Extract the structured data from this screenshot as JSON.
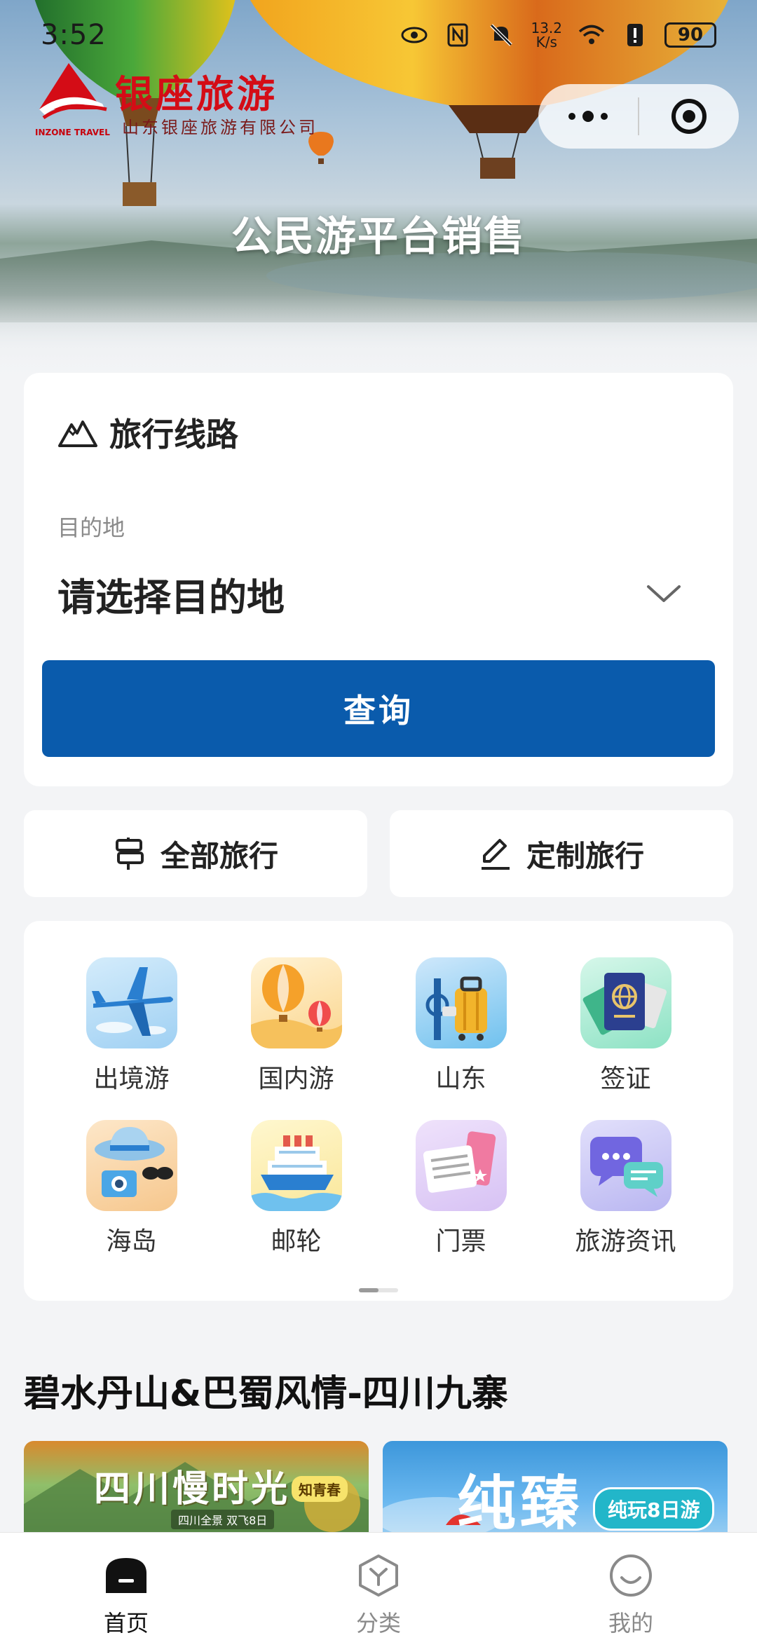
{
  "status_bar": {
    "time": "3:52",
    "net_speed_value": "13.2",
    "net_speed_unit": "K/s",
    "battery": "90"
  },
  "brand": {
    "name_cn": "银座旅游",
    "name_en": "INZONE TRAVEL",
    "subtitle": "山东银座旅游有限公司"
  },
  "hero": {
    "title": "公民游平台销售"
  },
  "search": {
    "section_title": "旅行线路",
    "destination_label": "目的地",
    "destination_placeholder": "请选择目的地",
    "query_button": "查询"
  },
  "quick_buttons": {
    "all_travel": "全部旅行",
    "custom_travel": "定制旅行"
  },
  "categories": [
    {
      "label": "出境游",
      "icon": "airplane-icon"
    },
    {
      "label": "国内游",
      "icon": "hot-air-balloon-icon"
    },
    {
      "label": "山东",
      "icon": "luggage-icon"
    },
    {
      "label": "签证",
      "icon": "passport-icon"
    },
    {
      "label": "海岛",
      "icon": "beach-hat-icon"
    },
    {
      "label": "邮轮",
      "icon": "cruise-ship-icon"
    },
    {
      "label": "门票",
      "icon": "ticket-icon"
    },
    {
      "label": "旅游资讯",
      "icon": "chat-bubble-icon"
    }
  ],
  "featured": {
    "section_title": "碧水丹山&巴蜀风情-四川九寨",
    "cards": [
      {
        "headline": "四川慢时光",
        "tag": "知青春",
        "sub": "四川全景 双飞8日"
      },
      {
        "headline": "纯臻",
        "badge": "纯玩8日游",
        "badge_script": "travel"
      }
    ]
  },
  "tabbar": {
    "items": [
      {
        "label": "首页",
        "active": true
      },
      {
        "label": "分类",
        "active": false
      },
      {
        "label": "我的",
        "active": false
      }
    ]
  },
  "colors": {
    "primary_button": "#0a5bac",
    "brand_red": "#d40c16",
    "page_background": "#f3f4f6"
  }
}
